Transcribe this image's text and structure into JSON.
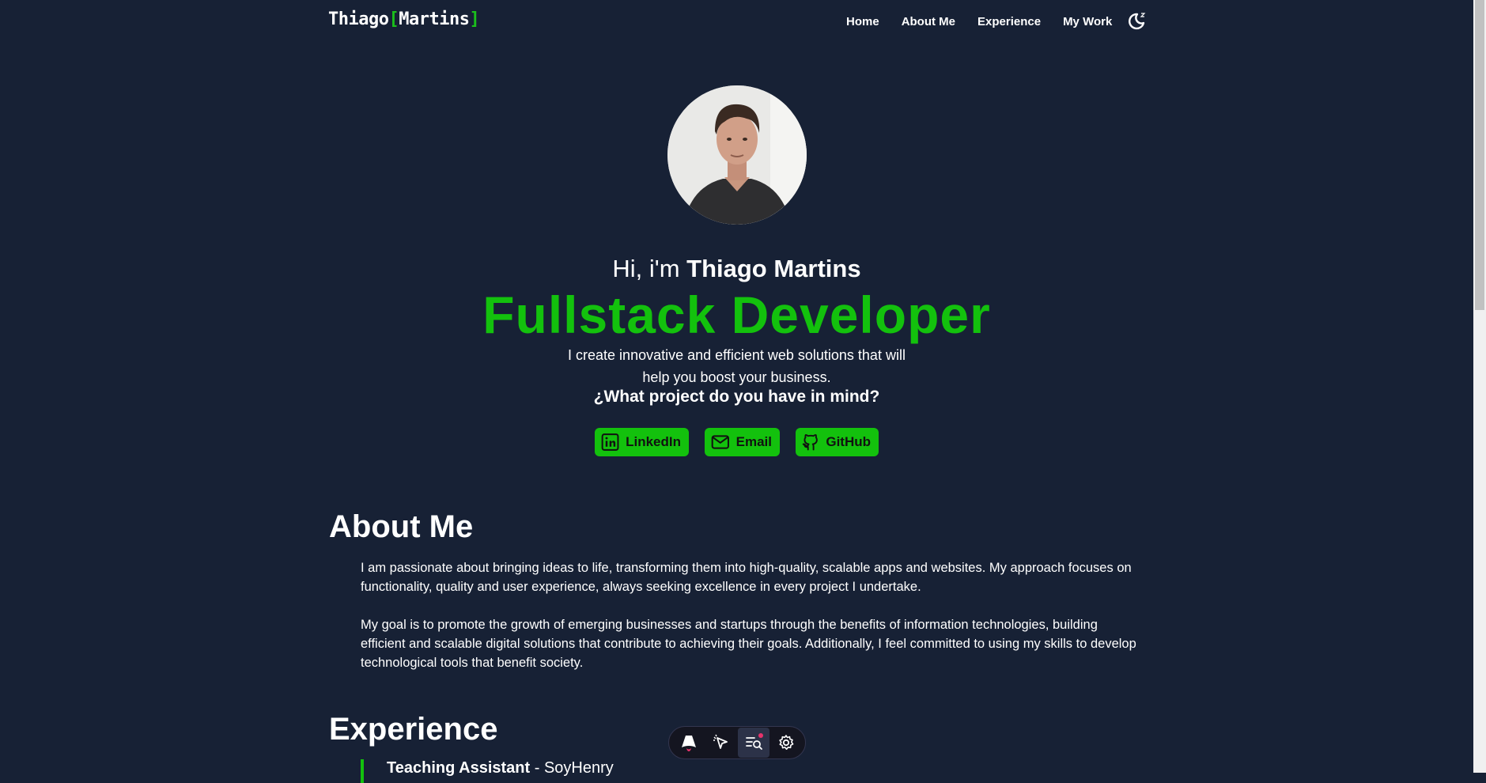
{
  "header": {
    "logo_first": "Thiago",
    "logo_open": "[",
    "logo_second": "Martins",
    "logo_close": "]",
    "nav": [
      {
        "label": "Home"
      },
      {
        "label": "About Me"
      },
      {
        "label": "Experience"
      },
      {
        "label": "My Work"
      }
    ],
    "theme_icon": "moon-stars-icon"
  },
  "hero": {
    "greeting_prefix": "Hi, i'm ",
    "name": "Thiago Martins",
    "role": "Fullstack Developer",
    "tagline_line1": "I create innovative and efficient web solutions that will",
    "tagline_line2": "help you boost your business.",
    "question": "¿What project do you have in mind?",
    "buttons": [
      {
        "label": "LinkedIn",
        "icon": "linkedin-icon"
      },
      {
        "label": "Email",
        "icon": "mail-icon"
      },
      {
        "label": "GitHub",
        "icon": "github-icon"
      }
    ]
  },
  "about": {
    "title": "About Me",
    "paragraph1": "I am passionate about bringing ideas to life, transforming them into high-quality, scalable apps and websites. My approach focuses on functionality, quality and user experience, always seeking excellence in every project I undertake.",
    "paragraph2": "My goal is to promote the growth of emerging businesses and startups through the benefits of information technologies, building efficient and scalable digital solutions that contribute to achieving their goals. Additionally, I feel committed to using my skills to develop technological tools that benefit society."
  },
  "experience": {
    "title": "Experience",
    "first_role": "Teaching Assistant",
    "first_sep": " - ",
    "first_company": "SoyHenry"
  },
  "devbar": {
    "icons": [
      "astro-logo-icon",
      "inspect-cursor-icon",
      "audit-icon",
      "settings-gear-icon"
    ]
  },
  "colors": {
    "background": "#172135",
    "accent": "#13c10d"
  }
}
